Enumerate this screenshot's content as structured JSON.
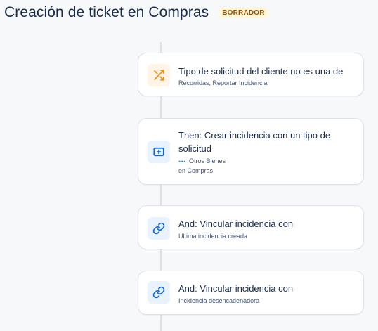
{
  "header": {
    "title": "Creación de ticket en Compras",
    "status": "BORRADOR"
  },
  "steps": [
    {
      "icon": "shuffle-icon",
      "title": "Tipo de solicitud del cliente no es una de",
      "subtitle": "Recorridas, Reportar Incidencia"
    },
    {
      "icon": "add-issue-icon",
      "title": "Then: Crear incidencia con un tipo de solicitud",
      "detail": "Otros Bienes",
      "subtitle": "en Compras"
    },
    {
      "icon": "link-icon",
      "title": "And: Vincular incidencia con",
      "subtitle": "Última incidencia creada"
    },
    {
      "icon": "link-icon",
      "title": "And: Vincular incidencia con",
      "subtitle": "Incidencia desencadenadora"
    }
  ],
  "colors": {
    "badge_bg": "#fff7d6",
    "badge_text": "#974f0c",
    "orange_icon": "#f18d13",
    "blue_icon": "#0c66e4",
    "dots": "#2ea6d8"
  }
}
